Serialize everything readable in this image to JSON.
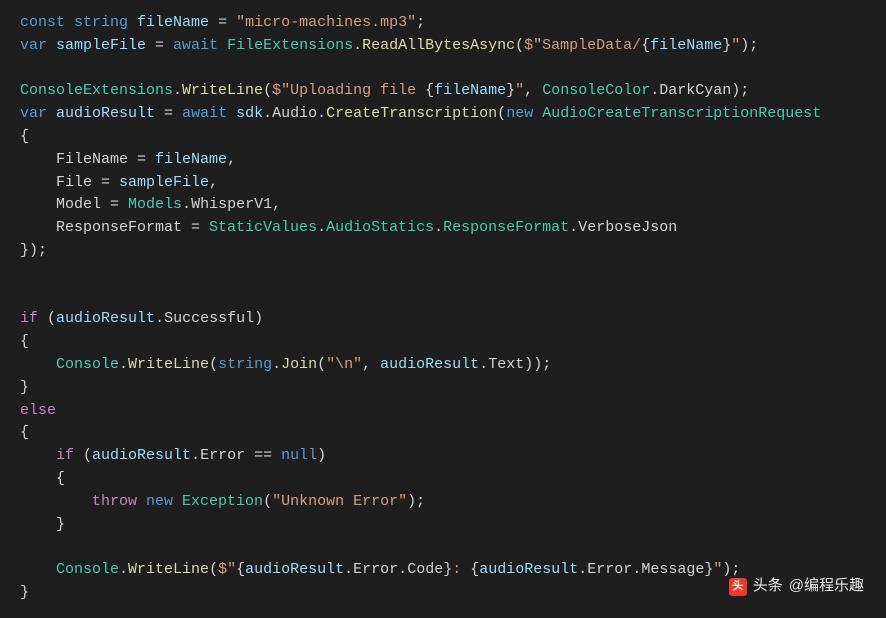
{
  "code": {
    "lines": [
      [
        {
          "t": "const ",
          "c": "kw"
        },
        {
          "t": "string",
          "c": "kw"
        },
        {
          "t": " ",
          "c": "punct"
        },
        {
          "t": "fileName",
          "c": "ident"
        },
        {
          "t": " = ",
          "c": "punct"
        },
        {
          "t": "\"micro-machines.mp3\"",
          "c": "str"
        },
        {
          "t": ";",
          "c": "punct"
        }
      ],
      [
        {
          "t": "var ",
          "c": "kw"
        },
        {
          "t": "sampleFile",
          "c": "ident"
        },
        {
          "t": " = ",
          "c": "punct"
        },
        {
          "t": "await ",
          "c": "kw"
        },
        {
          "t": "FileExtensions",
          "c": "type"
        },
        {
          "t": ".",
          "c": "punct"
        },
        {
          "t": "ReadAllBytesAsync",
          "c": "method"
        },
        {
          "t": "(",
          "c": "punct"
        },
        {
          "t": "$\"SampleData/",
          "c": "str"
        },
        {
          "t": "{",
          "c": "punct"
        },
        {
          "t": "fileName",
          "c": "ident"
        },
        {
          "t": "}",
          "c": "punct"
        },
        {
          "t": "\"",
          "c": "str"
        },
        {
          "t": ");",
          "c": "punct"
        }
      ],
      [],
      [
        {
          "t": "ConsoleExtensions",
          "c": "type"
        },
        {
          "t": ".",
          "c": "punct"
        },
        {
          "t": "WriteLine",
          "c": "method"
        },
        {
          "t": "(",
          "c": "punct"
        },
        {
          "t": "$\"Uploading file ",
          "c": "str"
        },
        {
          "t": "{",
          "c": "punct"
        },
        {
          "t": "fileName",
          "c": "ident"
        },
        {
          "t": "}",
          "c": "punct"
        },
        {
          "t": "\"",
          "c": "str"
        },
        {
          "t": ", ",
          "c": "punct"
        },
        {
          "t": "ConsoleColor",
          "c": "type"
        },
        {
          "t": ".",
          "c": "punct"
        },
        {
          "t": "DarkCyan",
          "c": "prop"
        },
        {
          "t": ");",
          "c": "punct"
        }
      ],
      [
        {
          "t": "var ",
          "c": "kw"
        },
        {
          "t": "audioResult",
          "c": "ident"
        },
        {
          "t": " = ",
          "c": "punct"
        },
        {
          "t": "await ",
          "c": "kw"
        },
        {
          "t": "sdk",
          "c": "ident"
        },
        {
          "t": ".",
          "c": "punct"
        },
        {
          "t": "Audio",
          "c": "prop"
        },
        {
          "t": ".",
          "c": "punct"
        },
        {
          "t": "CreateTranscription",
          "c": "method"
        },
        {
          "t": "(",
          "c": "punct"
        },
        {
          "t": "new ",
          "c": "kw"
        },
        {
          "t": "AudioCreateTranscriptionRequest",
          "c": "type"
        }
      ],
      [
        {
          "t": "{",
          "c": "punct"
        }
      ],
      [
        {
          "t": "    FileName",
          "c": "prop"
        },
        {
          "t": " = ",
          "c": "punct"
        },
        {
          "t": "fileName",
          "c": "ident"
        },
        {
          "t": ",",
          "c": "punct"
        }
      ],
      [
        {
          "t": "    File",
          "c": "prop"
        },
        {
          "t": " = ",
          "c": "punct"
        },
        {
          "t": "sampleFile",
          "c": "ident"
        },
        {
          "t": ",",
          "c": "punct"
        }
      ],
      [
        {
          "t": "    Model",
          "c": "prop"
        },
        {
          "t": " = ",
          "c": "punct"
        },
        {
          "t": "Models",
          "c": "type"
        },
        {
          "t": ".",
          "c": "punct"
        },
        {
          "t": "WhisperV1",
          "c": "prop"
        },
        {
          "t": ",",
          "c": "punct"
        }
      ],
      [
        {
          "t": "    ResponseFormat",
          "c": "prop"
        },
        {
          "t": " = ",
          "c": "punct"
        },
        {
          "t": "StaticValues",
          "c": "type"
        },
        {
          "t": ".",
          "c": "punct"
        },
        {
          "t": "AudioStatics",
          "c": "type"
        },
        {
          "t": ".",
          "c": "punct"
        },
        {
          "t": "ResponseFormat",
          "c": "type"
        },
        {
          "t": ".",
          "c": "punct"
        },
        {
          "t": "VerboseJson",
          "c": "prop"
        }
      ],
      [
        {
          "t": "});",
          "c": "punct"
        }
      ],
      [],
      [],
      [
        {
          "t": "if",
          "c": "ctrl"
        },
        {
          "t": " (",
          "c": "punct"
        },
        {
          "t": "audioResult",
          "c": "ident"
        },
        {
          "t": ".",
          "c": "punct"
        },
        {
          "t": "Successful",
          "c": "prop"
        },
        {
          "t": ")",
          "c": "punct"
        }
      ],
      [
        {
          "t": "{",
          "c": "punct"
        }
      ],
      [
        {
          "t": "    ",
          "c": "punct"
        },
        {
          "t": "Console",
          "c": "type"
        },
        {
          "t": ".",
          "c": "punct"
        },
        {
          "t": "WriteLine",
          "c": "method"
        },
        {
          "t": "(",
          "c": "punct"
        },
        {
          "t": "string",
          "c": "kw"
        },
        {
          "t": ".",
          "c": "punct"
        },
        {
          "t": "Join",
          "c": "method"
        },
        {
          "t": "(",
          "c": "punct"
        },
        {
          "t": "\"\\n\"",
          "c": "str"
        },
        {
          "t": ", ",
          "c": "punct"
        },
        {
          "t": "audioResult",
          "c": "ident"
        },
        {
          "t": ".",
          "c": "punct"
        },
        {
          "t": "Text",
          "c": "prop"
        },
        {
          "t": "));",
          "c": "punct"
        }
      ],
      [
        {
          "t": "}",
          "c": "punct"
        }
      ],
      [
        {
          "t": "else",
          "c": "ctrl"
        }
      ],
      [
        {
          "t": "{",
          "c": "punct"
        }
      ],
      [
        {
          "t": "    ",
          "c": "punct"
        },
        {
          "t": "if",
          "c": "ctrl"
        },
        {
          "t": " (",
          "c": "punct"
        },
        {
          "t": "audioResult",
          "c": "ident"
        },
        {
          "t": ".",
          "c": "punct"
        },
        {
          "t": "Error",
          "c": "prop"
        },
        {
          "t": " == ",
          "c": "punct"
        },
        {
          "t": "null",
          "c": "kw"
        },
        {
          "t": ")",
          "c": "punct"
        }
      ],
      [
        {
          "t": "    {",
          "c": "punct"
        }
      ],
      [
        {
          "t": "        ",
          "c": "punct"
        },
        {
          "t": "throw ",
          "c": "ctrl"
        },
        {
          "t": "new ",
          "c": "kw"
        },
        {
          "t": "Exception",
          "c": "type"
        },
        {
          "t": "(",
          "c": "punct"
        },
        {
          "t": "\"Unknown Error\"",
          "c": "str"
        },
        {
          "t": ");",
          "c": "punct"
        }
      ],
      [
        {
          "t": "    }",
          "c": "punct"
        }
      ],
      [],
      [
        {
          "t": "    ",
          "c": "punct"
        },
        {
          "t": "Console",
          "c": "type"
        },
        {
          "t": ".",
          "c": "punct"
        },
        {
          "t": "WriteLine",
          "c": "method"
        },
        {
          "t": "(",
          "c": "punct"
        },
        {
          "t": "$\"",
          "c": "str"
        },
        {
          "t": "{",
          "c": "punct"
        },
        {
          "t": "audioResult",
          "c": "ident"
        },
        {
          "t": ".",
          "c": "punct"
        },
        {
          "t": "Error",
          "c": "prop"
        },
        {
          "t": ".",
          "c": "punct"
        },
        {
          "t": "Code",
          "c": "prop"
        },
        {
          "t": "}",
          "c": "punct"
        },
        {
          "t": ": ",
          "c": "str"
        },
        {
          "t": "{",
          "c": "punct"
        },
        {
          "t": "audioResult",
          "c": "ident"
        },
        {
          "t": ".",
          "c": "punct"
        },
        {
          "t": "Error",
          "c": "prop"
        },
        {
          "t": ".",
          "c": "punct"
        },
        {
          "t": "Message",
          "c": "prop"
        },
        {
          "t": "}",
          "c": "punct"
        },
        {
          "t": "\"",
          "c": "str"
        },
        {
          "t": ");",
          "c": "punct"
        }
      ],
      [
        {
          "t": "}",
          "c": "punct"
        }
      ]
    ]
  },
  "watermark": {
    "prefix": "头条",
    "text": "@编程乐趣"
  }
}
